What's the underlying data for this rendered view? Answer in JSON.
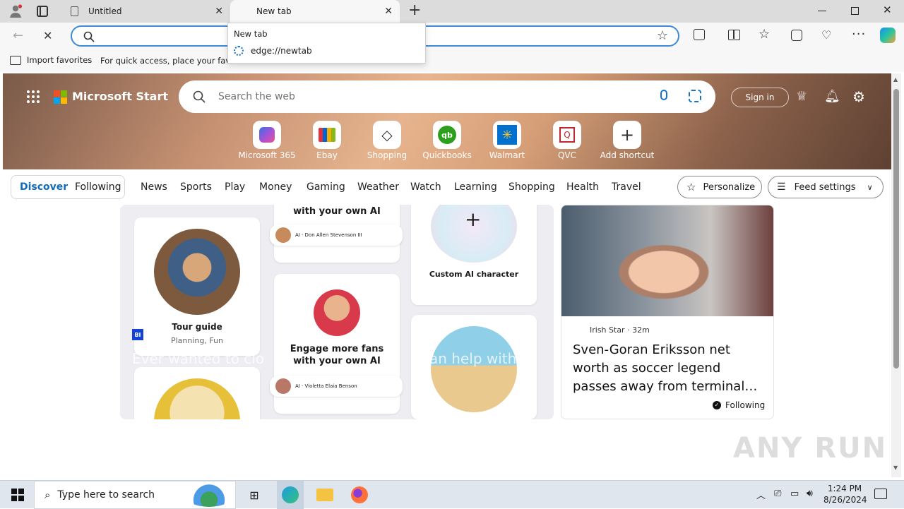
{
  "browser": {
    "tabs": [
      {
        "title": "Untitled"
      },
      {
        "title": "New tab"
      }
    ],
    "address": {
      "value": "",
      "placeholder": ""
    },
    "popup": {
      "header": "New tab",
      "suggestion": "edge://newtab"
    },
    "favorites": {
      "import_label": "Import favorites",
      "hint": "For quick access, place your favori"
    }
  },
  "page": {
    "brand": "Microsoft Start",
    "search_placeholder": "Search the web",
    "sign_in": "Sign in",
    "shortcuts": [
      {
        "label": "Microsoft 365",
        "icon": "microsoft-365-icon"
      },
      {
        "label": "Ebay",
        "icon": "ebay-icon"
      },
      {
        "label": "Shopping",
        "icon": "shopping-tag-icon"
      },
      {
        "label": "Quickbooks",
        "icon": "quickbooks-icon"
      },
      {
        "label": "Walmart",
        "icon": "walmart-icon"
      },
      {
        "label": "QVC",
        "icon": "qvc-icon"
      },
      {
        "label": "Add shortcut",
        "icon": "plus-icon"
      }
    ],
    "tabs": {
      "discover": "Discover",
      "following": "Following"
    },
    "nav": [
      "News",
      "Sports",
      "Play",
      "Money",
      "Gaming",
      "Weather",
      "Watch",
      "Learning",
      "Shopping",
      "Health",
      "Travel"
    ],
    "personalize": "Personalize",
    "feed_settings": "Feed settings",
    "feature": {
      "source_badge": "BI",
      "headline_overlay": "Ever wanted to clo",
      "headline_overlay_end": "an help with",
      "tour_title": "Tour guide",
      "tour_sub": "Planning, Fun",
      "ai_top": "with your own AI",
      "pill1": "AI · Don Allen Stevenson III",
      "custom_ai": "Custom AI character",
      "engage": "Engage more fans",
      "engage2": "with your own AI",
      "pill2": "AI · Violetta Elaia Benson"
    },
    "news": {
      "source": "Irish Star",
      "time": "32m",
      "headline": "Sven-Goran Eriksson net worth as soccer legend passes away from terminal…",
      "following": "Following"
    },
    "watermark": "ANY RUN"
  },
  "taskbar": {
    "search_placeholder": "Type here to search",
    "time": "1:24 PM",
    "date": "8/26/2024"
  },
  "colors": {
    "accent": "#0f6cbd",
    "address_border": "#3c8ad8",
    "hero_mid": "#e6b48e"
  }
}
